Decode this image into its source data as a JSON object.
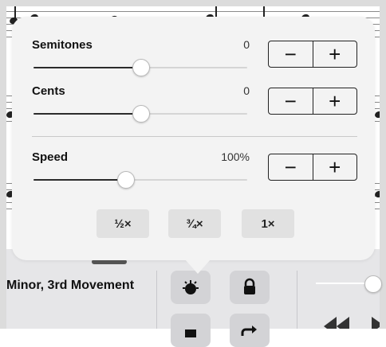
{
  "background": {
    "piece_title": "Minor, 3rd Movement"
  },
  "popover": {
    "semitones": {
      "label": "Semitones",
      "value": "0",
      "level": 0.5
    },
    "cents": {
      "label": "Cents",
      "value": "0",
      "level": 0.5
    },
    "speed": {
      "label": "Speed",
      "value": "100%",
      "level": 0.43
    },
    "stepper": {
      "minus": "−",
      "plus": "+"
    },
    "presets": [
      "½×",
      "¾×",
      "1×"
    ]
  },
  "toolbar": {
    "tuner_icon": "tuning-fork-icon",
    "lock_icon": "lock-icon",
    "stop_icon": "stop-icon",
    "redo_icon": "redo-icon",
    "rewind_icon": "rewind-icon",
    "play_icon": "play-icon"
  },
  "colors": {
    "popover_bg": "#f3f3f3",
    "frame": "#dcdcdc",
    "toolbar_bg": "#e6e6e8"
  }
}
